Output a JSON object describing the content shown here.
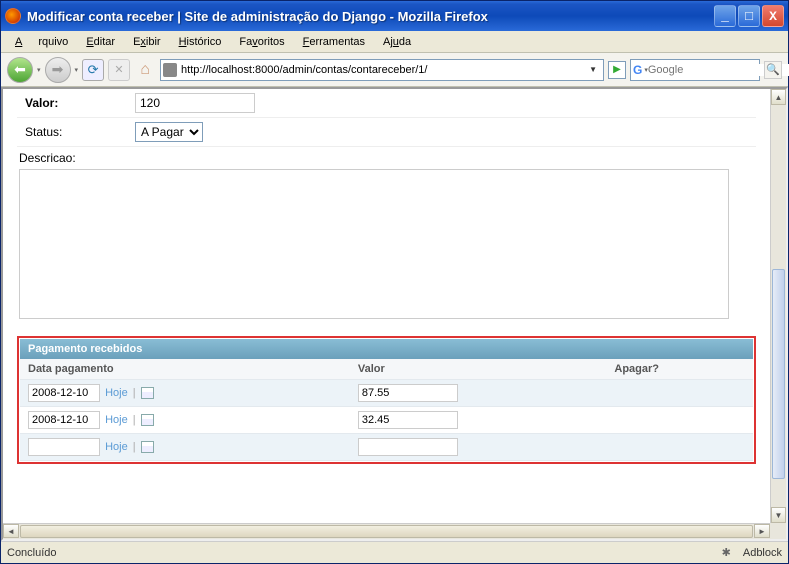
{
  "window": {
    "title": "Modificar conta receber | Site de administração do Django - Mozilla Firefox"
  },
  "menu": {
    "arquivo": "Arquivo",
    "editar": "Editar",
    "exibir": "Exibir",
    "historico": "Histórico",
    "favoritos": "Favoritos",
    "ferramentas": "Ferramentas",
    "ajuda": "Ajuda"
  },
  "toolbar": {
    "url": "http://localhost:8000/admin/contas/contareceber/1/",
    "search_placeholder": "Google"
  },
  "form": {
    "valor_label": "Valor:",
    "valor_value": "120",
    "status_label": "Status:",
    "status_value": "A Pagar",
    "descricao_label": "Descricao:",
    "descricao_value": ""
  },
  "inline": {
    "title": "Pagamento recebidos",
    "col_data": "Data pagamento",
    "col_valor": "Valor",
    "col_apagar": "Apagar?",
    "hoje": "Hoje",
    "rows": [
      {
        "data": "2008-12-10",
        "valor": "87.55"
      },
      {
        "data": "2008-12-10",
        "valor": "32.45"
      },
      {
        "data": "",
        "valor": ""
      }
    ]
  },
  "status": {
    "text": "Concluído",
    "adblock": "Adblock"
  }
}
